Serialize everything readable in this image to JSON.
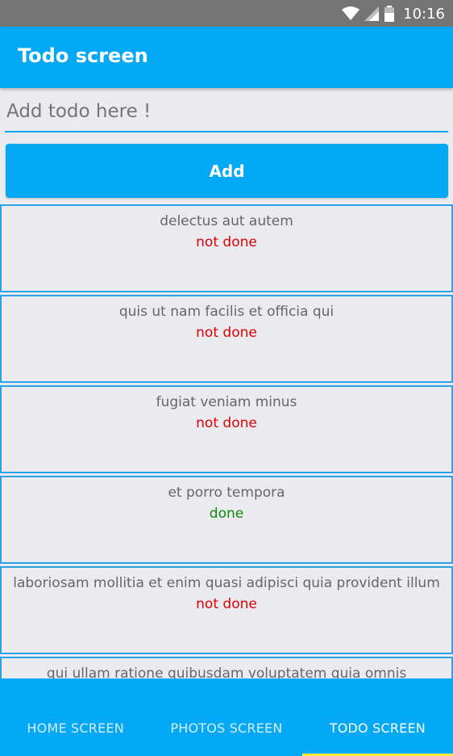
{
  "status_bar": {
    "time": "10:16",
    "icons": [
      "wifi-icon",
      "signal-icon",
      "battery-icon"
    ]
  },
  "app_bar": {
    "title": "Todo screen"
  },
  "todo_input": {
    "value": "",
    "placeholder": "Add todo here !"
  },
  "add_button": {
    "label": "Add"
  },
  "todos": [
    {
      "title": "delectus aut autem",
      "status": "not done",
      "color": "#e00000"
    },
    {
      "title": "quis ut nam facilis et officia qui",
      "status": "not done",
      "color": "#e00000"
    },
    {
      "title": "fugiat veniam minus",
      "status": "not done",
      "color": "#e00000"
    },
    {
      "title": "et porro tempora",
      "status": "done",
      "color": "#0a8a0a"
    },
    {
      "title": "laboriosam mollitia et enim quasi adipisci quia provident illum",
      "status": "not done",
      "color": "#e00000"
    },
    {
      "title": "qui ullam ratione quibusdam voluptatem quia omnis",
      "status": "",
      "color": "#e00000"
    }
  ],
  "bottom_nav": {
    "tabs": [
      {
        "label": "HOME SCREEN",
        "active": false
      },
      {
        "label": "PHOTOS SCREEN",
        "active": false
      },
      {
        "label": "TODO SCREEN",
        "active": true
      }
    ]
  },
  "colors": {
    "primary": "#03a9f4",
    "status_bar": "#747474",
    "background": "#ebebef",
    "tab_indicator": "#ffeb3b",
    "not_done": "#e00000",
    "done": "#0a8a0a"
  }
}
